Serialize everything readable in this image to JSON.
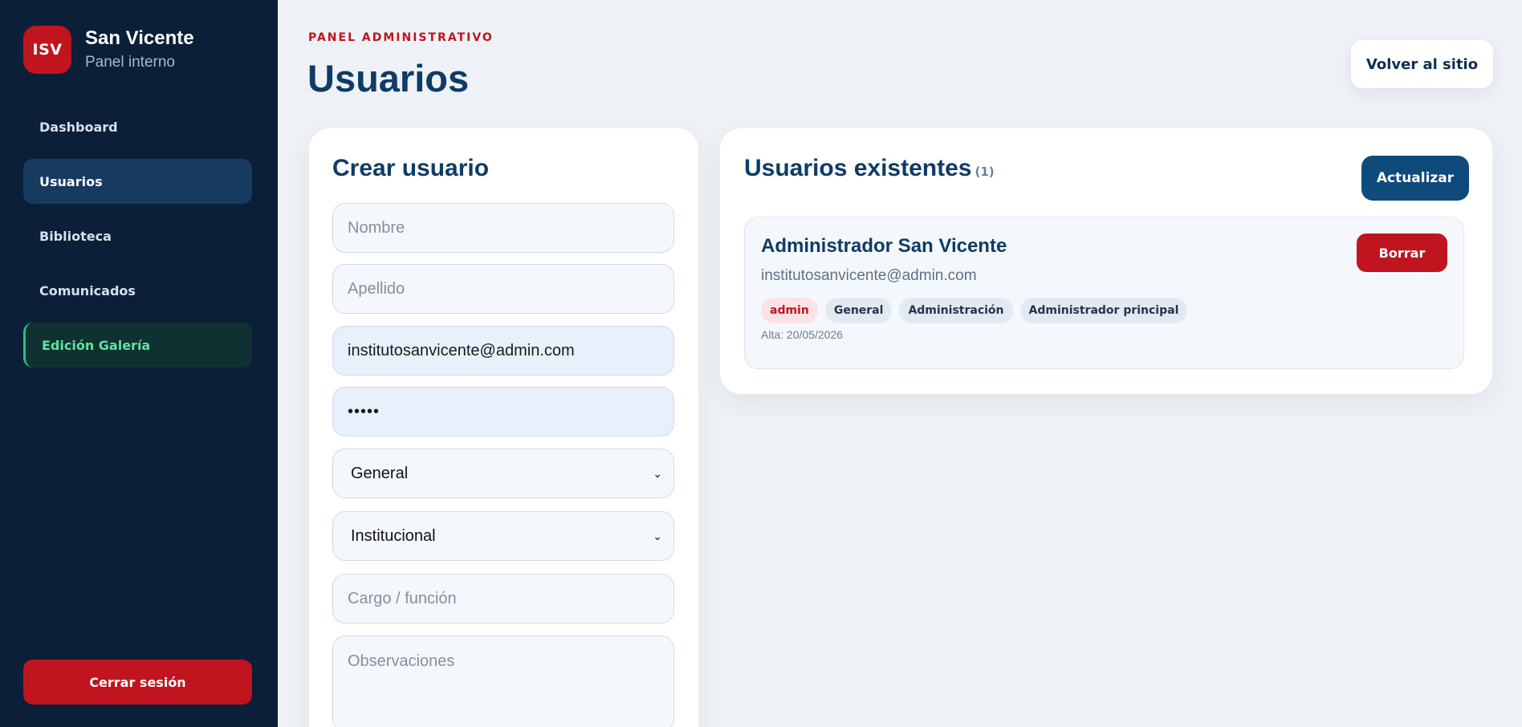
{
  "sidebar": {
    "logo": "ISV",
    "brand_name": "San Vicente",
    "brand_sub": "Panel interno",
    "items": [
      {
        "label": "Dashboard"
      },
      {
        "label": "Usuarios"
      },
      {
        "label": "Biblioteca"
      },
      {
        "label": "Comunicados"
      },
      {
        "label": "Edición Galería"
      }
    ],
    "logout_label": "Cerrar sesión"
  },
  "header": {
    "eyebrow": "PANEL ADMINISTRATIVO",
    "title": "Usuarios",
    "back_label": "Volver al sitio"
  },
  "create_form": {
    "title": "Crear usuario",
    "nombre_placeholder": "Nombre",
    "apellido_placeholder": "Apellido",
    "email_value": "institutosanvicente@admin.com",
    "password_value": "•••••",
    "role_select": "General",
    "area_select": "Institucional",
    "cargo_placeholder": "Cargo / función",
    "observaciones_placeholder": "Observaciones"
  },
  "user_list": {
    "title": "Usuarios existentes",
    "count": "(1)",
    "refresh_label": "Actualizar",
    "users": [
      {
        "name": "Administrador San Vicente",
        "email": "institutosanvicente@admin.com",
        "tags": [
          "admin",
          "General",
          "Administración",
          "Administrador principal"
        ],
        "date": "Alta: 20/05/2026",
        "delete_label": "Borrar"
      }
    ]
  },
  "colors": {
    "sidebar_bg": "#0b1f38",
    "accent_red": "#c0141f",
    "primary_blue": "#0f4a7d",
    "page_bg": "#eef2f6",
    "gallery_green": "#5fe39a"
  }
}
